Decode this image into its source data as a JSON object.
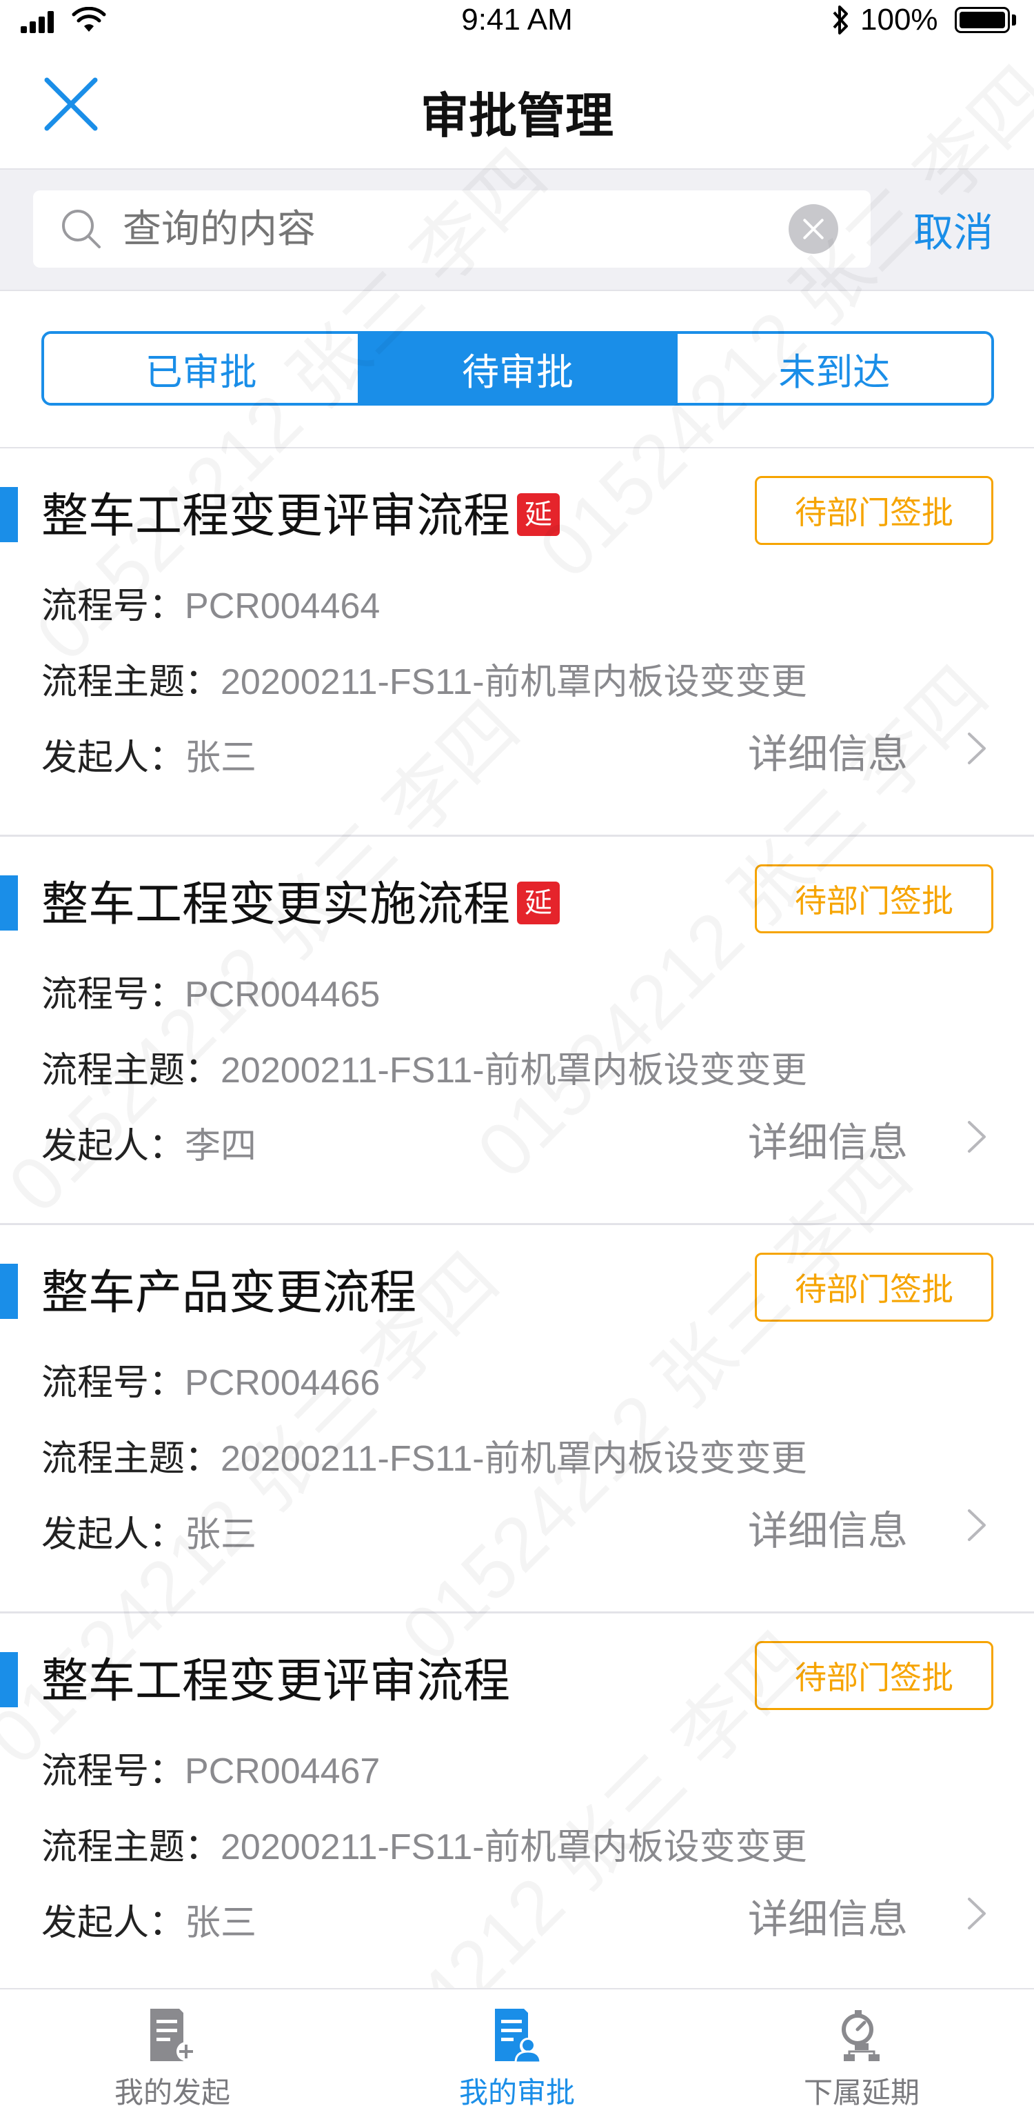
{
  "status_bar": {
    "time": "9:41 AM",
    "battery": "100%"
  },
  "nav": {
    "title": "审批管理",
    "close_icon": "close-icon"
  },
  "search": {
    "placeholder": "查询的内容",
    "value": "查询的内容",
    "cancel_label": "取消"
  },
  "segments": [
    {
      "label": "已审批",
      "active": false
    },
    {
      "label": "待审批",
      "active": true
    },
    {
      "label": "未到达",
      "active": false
    }
  ],
  "labels": {
    "process_no": "流程号：",
    "subject": "流程主题：",
    "initiator": "发起人：",
    "detail": "详细信息"
  },
  "cards": [
    {
      "title": "整车工程变更评审流程",
      "badge": "延",
      "status": "待部门签批",
      "process_no": "PCR004464",
      "subject": "20200211-FS11-前机罩内板设变变更",
      "initiator": "张三"
    },
    {
      "title": "整车工程变更实施流程",
      "badge": "延",
      "status": "待部门签批",
      "process_no": "PCR004465",
      "subject": "20200211-FS11-前机罩内板设变变更",
      "initiator": "李四"
    },
    {
      "title": "整车产品变更流程",
      "badge": "",
      "status": "待部门签批",
      "process_no": "PCR004466",
      "subject": "20200211-FS11-前机罩内板设变变更",
      "initiator": "张三"
    },
    {
      "title": "整车工程变更评审流程",
      "badge": "",
      "status": "待部门签批",
      "process_no": "PCR004467",
      "subject": "20200211-FS11-前机罩内板设变变更",
      "initiator": "张三"
    }
  ],
  "tabbar": [
    {
      "label": "我的发起",
      "icon": "document-add-icon",
      "active": false
    },
    {
      "label": "我的审批",
      "icon": "document-user-icon",
      "active": true
    },
    {
      "label": "下属延期",
      "icon": "timer-hierarchy-icon",
      "active": false
    }
  ],
  "watermark": {
    "text": "01524212 张三 李四"
  },
  "colors": {
    "accent": "#1a8ee8",
    "status": "#f6a400",
    "badge": "#e5242b"
  }
}
